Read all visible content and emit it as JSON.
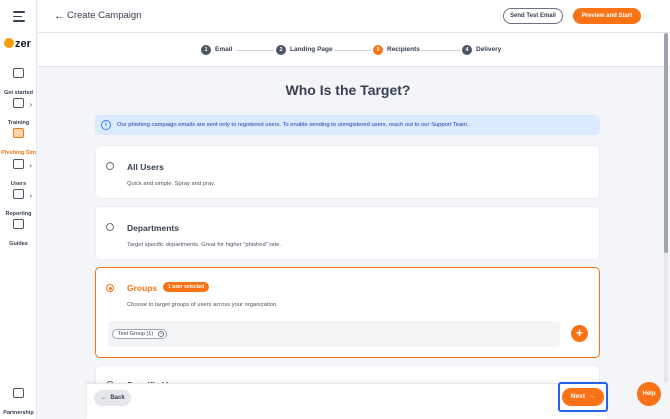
{
  "sidebar": {
    "logo_text": "zer",
    "items": [
      {
        "label": "Get started",
        "icon": "rocket-icon"
      },
      {
        "label": "Training",
        "icon": "graduation-icon"
      },
      {
        "label": "Phishing Sim",
        "icon": "hook-icon"
      },
      {
        "label": "Users",
        "icon": "users-icon"
      },
      {
        "label": "Reporting",
        "icon": "report-icon"
      },
      {
        "label": "Guides",
        "icon": "book-icon"
      },
      {
        "label": "Partnership",
        "icon": "building-icon"
      }
    ],
    "active_index": 2
  },
  "header": {
    "title": "Create Campaign",
    "send_test_label": "Send Test Email",
    "preview_label": "Preview and Start"
  },
  "stepper": {
    "steps": [
      {
        "num": "1",
        "label": "Email"
      },
      {
        "num": "2",
        "label": "Landing Page"
      },
      {
        "num": "3",
        "label": "Recipients"
      },
      {
        "num": "4",
        "label": "Delivery"
      }
    ],
    "active_index": 2
  },
  "main": {
    "title": "Who Is the Target?",
    "info": "Our phishing campaign emails are sent only to registered users. To enable sending to unregistered users, reach out to our Support Team.",
    "options": [
      {
        "title": "All Users",
        "desc": "Quick and simple. Spray and pray."
      },
      {
        "title": "Departments",
        "desc": "Target specific departments. Great for higher \"phished\" rate."
      },
      {
        "title": "Groups",
        "desc": "Choose to target groups of users across your organization.",
        "badge": "1 user selected"
      },
      {
        "title": "Specific Users"
      }
    ],
    "selected_chip": "Test Group (1)"
  },
  "footer": {
    "back_label": "Back",
    "next_label": "Next",
    "help_label": "Help"
  },
  "colors": {
    "accent": "#f97316",
    "info_bg": "#dbeafe",
    "highlight": "#2563eb"
  }
}
